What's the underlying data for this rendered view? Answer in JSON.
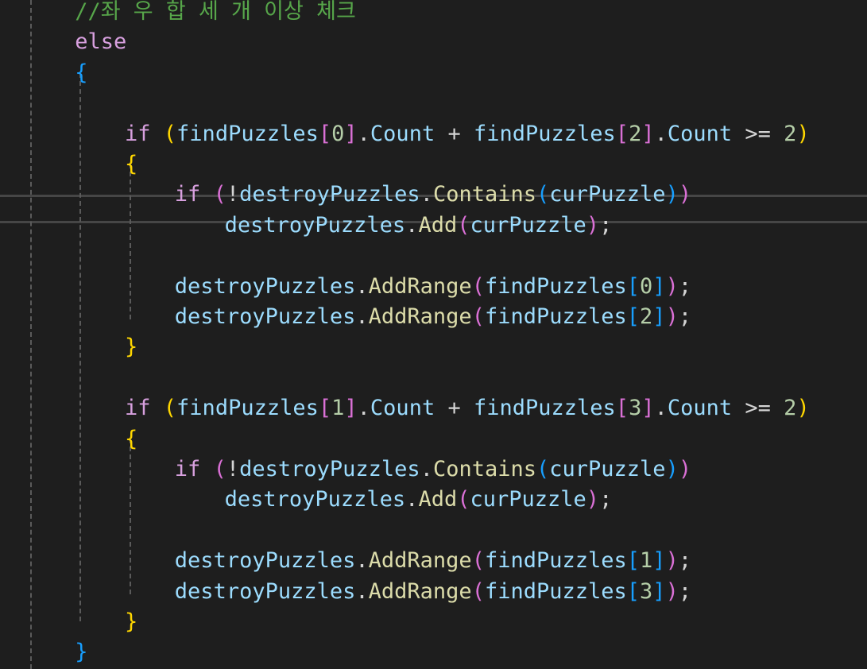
{
  "editor": {
    "lines": [
      {
        "indent": 3,
        "tokens": [
          [
            "cm",
            "//좌 우 합 세 개 이상 체크"
          ]
        ]
      },
      {
        "indent": 3,
        "tokens": [
          [
            "kw",
            "else"
          ]
        ]
      },
      {
        "indent": 3,
        "tokens": [
          [
            "b3",
            "{"
          ]
        ]
      },
      {
        "indent": 0,
        "tokens": []
      },
      {
        "indent": 5,
        "tokens": [
          [
            "kw",
            "if"
          ],
          [
            "pl",
            " "
          ],
          [
            "b1",
            "("
          ],
          [
            "id",
            "findPuzzles"
          ],
          [
            "b2",
            "["
          ],
          [
            "num",
            "0"
          ],
          [
            "b2",
            "]"
          ],
          [
            "pl",
            "."
          ],
          [
            "id",
            "Count"
          ],
          [
            "pl",
            " + "
          ],
          [
            "id",
            "findPuzzles"
          ],
          [
            "b2",
            "["
          ],
          [
            "num",
            "2"
          ],
          [
            "b2",
            "]"
          ],
          [
            "pl",
            "."
          ],
          [
            "id",
            "Count"
          ],
          [
            "pl",
            " >= "
          ],
          [
            "num",
            "2"
          ],
          [
            "b1",
            ")"
          ]
        ]
      },
      {
        "indent": 5,
        "tokens": [
          [
            "b1",
            "{"
          ]
        ]
      },
      {
        "indent": 7,
        "tokens": [
          [
            "kw",
            "if"
          ],
          [
            "pl",
            " "
          ],
          [
            "b2",
            "("
          ],
          [
            "pl",
            "!"
          ],
          [
            "id",
            "destroyPuzzles"
          ],
          [
            "pl",
            "."
          ],
          [
            "fn",
            "Contains"
          ],
          [
            "b3",
            "("
          ],
          [
            "id",
            "curPuzzle"
          ],
          [
            "b3",
            ")"
          ],
          [
            "b2",
            ")"
          ]
        ]
      },
      {
        "indent": 9,
        "tokens": [
          [
            "id",
            "destroyPuzzles"
          ],
          [
            "pl",
            "."
          ],
          [
            "fn",
            "Add"
          ],
          [
            "b2",
            "("
          ],
          [
            "id",
            "curPuzzle"
          ],
          [
            "b2",
            ")"
          ],
          [
            "pl",
            ";"
          ]
        ]
      },
      {
        "indent": 0,
        "tokens": []
      },
      {
        "indent": 7,
        "tokens": [
          [
            "id",
            "destroyPuzzles"
          ],
          [
            "pl",
            "."
          ],
          [
            "fn",
            "AddRange"
          ],
          [
            "b2",
            "("
          ],
          [
            "id",
            "findPuzzles"
          ],
          [
            "b3",
            "["
          ],
          [
            "num",
            "0"
          ],
          [
            "b3",
            "]"
          ],
          [
            "b2",
            ")"
          ],
          [
            "pl",
            ";"
          ]
        ]
      },
      {
        "indent": 7,
        "tokens": [
          [
            "id",
            "destroyPuzzles"
          ],
          [
            "pl",
            "."
          ],
          [
            "fn",
            "AddRange"
          ],
          [
            "b2",
            "("
          ],
          [
            "id",
            "findPuzzles"
          ],
          [
            "b3",
            "["
          ],
          [
            "num",
            "2"
          ],
          [
            "b3",
            "]"
          ],
          [
            "b2",
            ")"
          ],
          [
            "pl",
            ";"
          ]
        ]
      },
      {
        "indent": 5,
        "tokens": [
          [
            "b1",
            "}"
          ]
        ]
      },
      {
        "indent": 0,
        "tokens": []
      },
      {
        "indent": 5,
        "tokens": [
          [
            "kw",
            "if"
          ],
          [
            "pl",
            " "
          ],
          [
            "b1",
            "("
          ],
          [
            "id",
            "findPuzzles"
          ],
          [
            "b2",
            "["
          ],
          [
            "num",
            "1"
          ],
          [
            "b2",
            "]"
          ],
          [
            "pl",
            "."
          ],
          [
            "id",
            "Count"
          ],
          [
            "pl",
            " + "
          ],
          [
            "id",
            "findPuzzles"
          ],
          [
            "b2",
            "["
          ],
          [
            "num",
            "3"
          ],
          [
            "b2",
            "]"
          ],
          [
            "pl",
            "."
          ],
          [
            "id",
            "Count"
          ],
          [
            "pl",
            " >= "
          ],
          [
            "num",
            "2"
          ],
          [
            "b1",
            ")"
          ]
        ]
      },
      {
        "indent": 5,
        "tokens": [
          [
            "b1",
            "{"
          ]
        ]
      },
      {
        "indent": 7,
        "tokens": [
          [
            "kw",
            "if"
          ],
          [
            "pl",
            " "
          ],
          [
            "b2",
            "("
          ],
          [
            "pl",
            "!"
          ],
          [
            "id",
            "destroyPuzzles"
          ],
          [
            "pl",
            "."
          ],
          [
            "fn",
            "Contains"
          ],
          [
            "b3",
            "("
          ],
          [
            "id",
            "curPuzzle"
          ],
          [
            "b3",
            ")"
          ],
          [
            "b2",
            ")"
          ]
        ]
      },
      {
        "indent": 9,
        "tokens": [
          [
            "id",
            "destroyPuzzles"
          ],
          [
            "pl",
            "."
          ],
          [
            "fn",
            "Add"
          ],
          [
            "b2",
            "("
          ],
          [
            "id",
            "curPuzzle"
          ],
          [
            "b2",
            ")"
          ],
          [
            "pl",
            ";"
          ]
        ]
      },
      {
        "indent": 0,
        "tokens": []
      },
      {
        "indent": 7,
        "tokens": [
          [
            "id",
            "destroyPuzzles"
          ],
          [
            "pl",
            "."
          ],
          [
            "fn",
            "AddRange"
          ],
          [
            "b2",
            "("
          ],
          [
            "id",
            "findPuzzles"
          ],
          [
            "b3",
            "["
          ],
          [
            "num",
            "1"
          ],
          [
            "b3",
            "]"
          ],
          [
            "b2",
            ")"
          ],
          [
            "pl",
            ";"
          ]
        ]
      },
      {
        "indent": 7,
        "tokens": [
          [
            "id",
            "destroyPuzzles"
          ],
          [
            "pl",
            "."
          ],
          [
            "fn",
            "AddRange"
          ],
          [
            "b2",
            "("
          ],
          [
            "id",
            "findPuzzles"
          ],
          [
            "b3",
            "["
          ],
          [
            "num",
            "3"
          ],
          [
            "b3",
            "]"
          ],
          [
            "b2",
            ")"
          ],
          [
            "pl",
            ";"
          ]
        ]
      },
      {
        "indent": 5,
        "tokens": [
          [
            "b1",
            "}"
          ]
        ]
      },
      {
        "indent": 3,
        "tokens": [
          [
            "b3",
            "}"
          ]
        ]
      }
    ]
  }
}
